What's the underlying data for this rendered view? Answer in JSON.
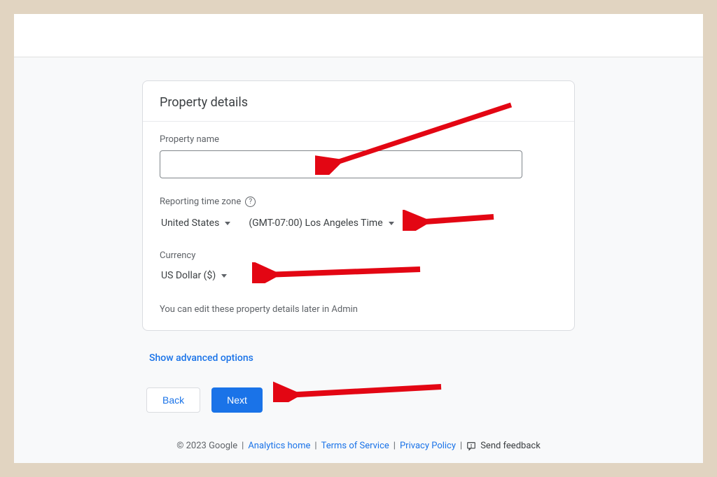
{
  "card": {
    "title": "Property details",
    "propertyName": {
      "label": "Property name",
      "value": ""
    },
    "timezone": {
      "label": "Reporting time zone",
      "country": "United States",
      "zone": "(GMT-07:00) Los Angeles Time"
    },
    "currency": {
      "label": "Currency",
      "value": "US Dollar ($)"
    },
    "hint": "You can edit these property details later in Admin"
  },
  "advanced": "Show advanced options",
  "buttons": {
    "back": "Back",
    "next": "Next"
  },
  "footer": {
    "copyright": "© 2023 Google",
    "links": {
      "analytics": "Analytics home",
      "terms": "Terms of Service",
      "privacy": "Privacy Policy"
    },
    "feedback": "Send feedback"
  }
}
